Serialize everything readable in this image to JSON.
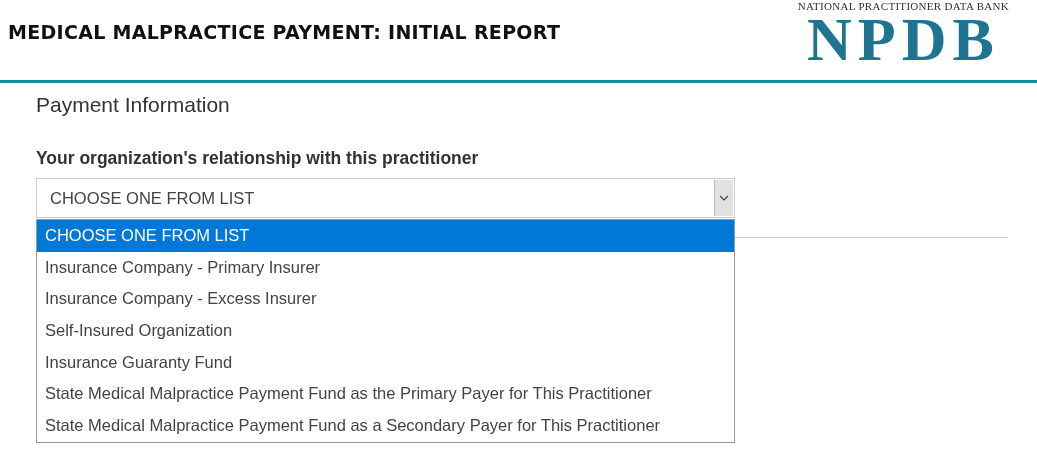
{
  "header": {
    "title": "MEDICAL MALPRACTICE PAYMENT: INITIAL REPORT",
    "logo_tagline": "NATIONAL PRACTITIONER DATA BANK",
    "logo_mark": "NPDB"
  },
  "section": {
    "heading": "Payment Information",
    "field": {
      "label": "Your organization's relationship with this practitioner",
      "value": "CHOOSE ONE FROM LIST",
      "expanded": true,
      "options": [
        {
          "label": "CHOOSE ONE FROM LIST",
          "selected": true
        },
        {
          "label": "Insurance Company - Primary Insurer",
          "selected": false
        },
        {
          "label": "Insurance Company - Excess Insurer",
          "selected": false
        },
        {
          "label": "Self-Insured Organization",
          "selected": false
        },
        {
          "label": "Insurance Guaranty Fund",
          "selected": false
        },
        {
          "label": "State Medical Malpractice Payment Fund as the Primary Payer for This Practitioner",
          "selected": false
        },
        {
          "label": "State Medical Malpractice Payment Fund as a Secondary Payer for This Practitioner",
          "selected": false
        }
      ]
    }
  }
}
